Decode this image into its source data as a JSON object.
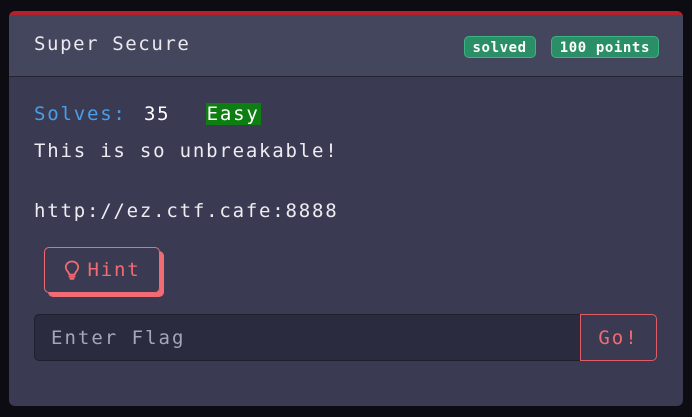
{
  "challenge": {
    "title": "Super Secure",
    "badges": {
      "status": "solved",
      "points": "100 points"
    },
    "solves_label": "Solves:",
    "solves_count": "35",
    "difficulty": "Easy",
    "description_line1": "This is so unbreakable!",
    "description_line2": "http://ez.ctf.cafe:8888",
    "hint_label": "Hint",
    "flag_input": {
      "value": "",
      "placeholder": "Enter Flag"
    },
    "submit_label": "Go!"
  },
  "colors": {
    "accent_red": "#f06b73",
    "top_border": "#b3222c",
    "badge_green": "#2a8f66",
    "difficulty_green": "#0e7d12",
    "solves_blue": "#4a9ee8",
    "card_bg": "#3a3b52"
  },
  "icons": {
    "hint": "lightbulb-icon"
  }
}
